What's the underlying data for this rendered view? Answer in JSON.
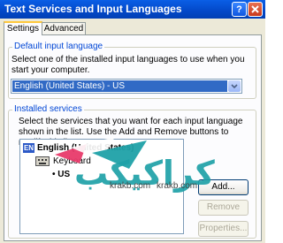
{
  "window": {
    "title": "Text Services and Input Languages"
  },
  "tabs": [
    {
      "label": "Settings"
    },
    {
      "label": "Advanced"
    }
  ],
  "default_language": {
    "group_label": "Default input language",
    "description": "Select one of the installed input languages to use when you start your computer.",
    "selected": "English (United States) - US"
  },
  "installed_services": {
    "group_label": "Installed services",
    "description": "Select the services that you want for each input language shown in the list. Use the Add and Remove buttons to modify this list.",
    "language_badge": "EN",
    "language": "English (United States)",
    "keyboard_label": "Keyboard",
    "layout": "US",
    "buttons": {
      "add": "Add...",
      "remove": "Remove",
      "properties": "Properties..."
    }
  },
  "watermark": {
    "arabic": "كراكيكب",
    "url_left": "krakb.com",
    "url_right": "krakb.com"
  }
}
